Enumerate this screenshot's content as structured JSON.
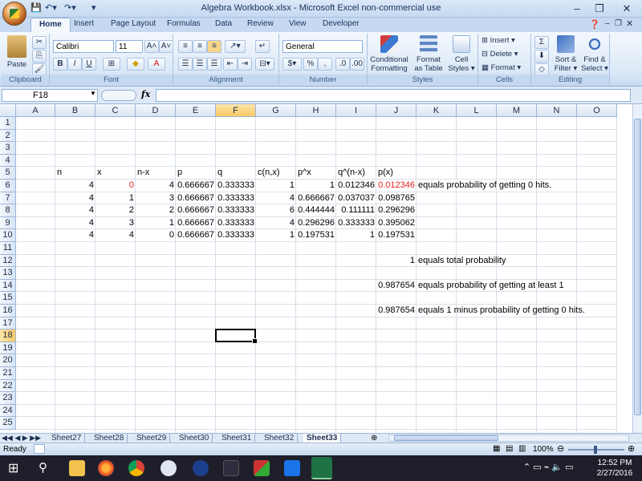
{
  "window": {
    "title": "Algebra Workbook.xlsx - Microsoft Excel non-commercial use",
    "controls": {
      "minimize": "–",
      "restore": "❐",
      "close": "✕"
    }
  },
  "ribbon_tabs": [
    "Home",
    "Insert",
    "Page Layout",
    "Formulas",
    "Data",
    "Review",
    "View",
    "Developer"
  ],
  "ribbon": {
    "clipboard": {
      "label": "Clipboard",
      "paste": "Paste"
    },
    "font": {
      "label": "Font",
      "name": "Calibri",
      "size": "11"
    },
    "alignment": {
      "label": "Alignment"
    },
    "number": {
      "label": "Number",
      "format": "General"
    },
    "styles": {
      "label": "Styles",
      "cond": "Conditional Formatting ▾",
      "table": "Format as Table ▾",
      "cell": "Cell Styles ▾"
    },
    "cells": {
      "label": "Cells",
      "insert": "Insert ▾",
      "delete": "Delete ▾",
      "format": "Format ▾"
    },
    "editing": {
      "label": "Editing",
      "sort": "Sort & Filter ▾",
      "find": "Find & Select ▾"
    }
  },
  "formula_bar": {
    "name_box": "F18",
    "fx": "fx",
    "formula": ""
  },
  "columns": [
    "A",
    "B",
    "C",
    "D",
    "E",
    "F",
    "G",
    "H",
    "I",
    "J",
    "K",
    "L",
    "M",
    "N",
    "O"
  ],
  "rows": [
    "1",
    "2",
    "3",
    "4",
    "5",
    "6",
    "7",
    "8",
    "9",
    "10",
    "11",
    "12",
    "13",
    "14",
    "15",
    "16",
    "17",
    "18",
    "19",
    "20",
    "21",
    "22",
    "23",
    "24",
    "25"
  ],
  "cells": [
    {
      "col": 1,
      "row": 5,
      "text": "n"
    },
    {
      "col": 2,
      "row": 5,
      "text": "x"
    },
    {
      "col": 3,
      "row": 5,
      "text": "n-x"
    },
    {
      "col": 4,
      "row": 5,
      "text": "p"
    },
    {
      "col": 5,
      "row": 5,
      "text": "q"
    },
    {
      "col": 6,
      "row": 5,
      "text": "c(n,x)"
    },
    {
      "col": 7,
      "row": 5,
      "text": "p^x"
    },
    {
      "col": 8,
      "row": 5,
      "text": "q^(n-x)"
    },
    {
      "col": 9,
      "row": 5,
      "text": "p(x)"
    },
    {
      "col": 1,
      "row": 6,
      "text": "4",
      "num": true
    },
    {
      "col": 2,
      "row": 6,
      "text": "0",
      "num": true,
      "red": true
    },
    {
      "col": 3,
      "row": 6,
      "text": "4",
      "num": true
    },
    {
      "col": 4,
      "row": 6,
      "text": "0.666667",
      "num": true
    },
    {
      "col": 5,
      "row": 6,
      "text": "0.333333",
      "num": true
    },
    {
      "col": 6,
      "row": 6,
      "text": "1",
      "num": true
    },
    {
      "col": 7,
      "row": 6,
      "text": "1",
      "num": true
    },
    {
      "col": 8,
      "row": 6,
      "text": "0.012346",
      "num": true
    },
    {
      "col": 9,
      "row": 6,
      "text": "0.012346",
      "num": true,
      "red": true
    },
    {
      "col": 10,
      "row": 6,
      "text": "equals probability of getting 0 hits."
    },
    {
      "col": 1,
      "row": 7,
      "text": "4",
      "num": true
    },
    {
      "col": 2,
      "row": 7,
      "text": "1",
      "num": true
    },
    {
      "col": 3,
      "row": 7,
      "text": "3",
      "num": true
    },
    {
      "col": 4,
      "row": 7,
      "text": "0.666667",
      "num": true
    },
    {
      "col": 5,
      "row": 7,
      "text": "0.333333",
      "num": true
    },
    {
      "col": 6,
      "row": 7,
      "text": "4",
      "num": true
    },
    {
      "col": 7,
      "row": 7,
      "text": "0.666667",
      "num": true
    },
    {
      "col": 8,
      "row": 7,
      "text": "0.037037",
      "num": true
    },
    {
      "col": 9,
      "row": 7,
      "text": "0.098765",
      "num": true
    },
    {
      "col": 1,
      "row": 8,
      "text": "4",
      "num": true
    },
    {
      "col": 2,
      "row": 8,
      "text": "2",
      "num": true
    },
    {
      "col": 3,
      "row": 8,
      "text": "2",
      "num": true
    },
    {
      "col": 4,
      "row": 8,
      "text": "0.666667",
      "num": true
    },
    {
      "col": 5,
      "row": 8,
      "text": "0.333333",
      "num": true
    },
    {
      "col": 6,
      "row": 8,
      "text": "6",
      "num": true
    },
    {
      "col": 7,
      "row": 8,
      "text": "0.444444",
      "num": true
    },
    {
      "col": 8,
      "row": 8,
      "text": "0.111111",
      "num": true
    },
    {
      "col": 9,
      "row": 8,
      "text": "0.296296",
      "num": true
    },
    {
      "col": 1,
      "row": 9,
      "text": "4",
      "num": true
    },
    {
      "col": 2,
      "row": 9,
      "text": "3",
      "num": true
    },
    {
      "col": 3,
      "row": 9,
      "text": "1",
      "num": true
    },
    {
      "col": 4,
      "row": 9,
      "text": "0.666667",
      "num": true
    },
    {
      "col": 5,
      "row": 9,
      "text": "0.333333",
      "num": true
    },
    {
      "col": 6,
      "row": 9,
      "text": "4",
      "num": true
    },
    {
      "col": 7,
      "row": 9,
      "text": "0.296296",
      "num": true
    },
    {
      "col": 8,
      "row": 9,
      "text": "0.333333",
      "num": true
    },
    {
      "col": 9,
      "row": 9,
      "text": "0.395062",
      "num": true
    },
    {
      "col": 1,
      "row": 10,
      "text": "4",
      "num": true
    },
    {
      "col": 2,
      "row": 10,
      "text": "4",
      "num": true
    },
    {
      "col": 3,
      "row": 10,
      "text": "0",
      "num": true
    },
    {
      "col": 4,
      "row": 10,
      "text": "0.666667",
      "num": true
    },
    {
      "col": 5,
      "row": 10,
      "text": "0.333333",
      "num": true
    },
    {
      "col": 6,
      "row": 10,
      "text": "1",
      "num": true
    },
    {
      "col": 7,
      "row": 10,
      "text": "0.197531",
      "num": true
    },
    {
      "col": 8,
      "row": 10,
      "text": "1",
      "num": true
    },
    {
      "col": 9,
      "row": 10,
      "text": "0.197531",
      "num": true
    },
    {
      "col": 9,
      "row": 12,
      "text": "1",
      "num": true
    },
    {
      "col": 10,
      "row": 12,
      "text": "equals total probability"
    },
    {
      "col": 9,
      "row": 14,
      "text": "0.987654",
      "num": true
    },
    {
      "col": 10,
      "row": 14,
      "text": "equals probability of getting at least 1"
    },
    {
      "col": 9,
      "row": 16,
      "text": "0.987654",
      "num": true
    },
    {
      "col": 10,
      "row": 16,
      "text": "equals 1 minus probability of getting 0 hits."
    }
  ],
  "active_cell": {
    "col": 5,
    "row": 18
  },
  "sheets": [
    "Sheet27",
    "Sheet28",
    "Sheet29",
    "Sheet30",
    "Sheet31",
    "Sheet32",
    "Sheet33"
  ],
  "active_sheet": "Sheet33",
  "status": {
    "ready": "Ready",
    "zoom": "100%"
  },
  "clock": {
    "time": "12:52 PM",
    "date": "2/27/2016"
  },
  "colors": {
    "accent": "#c6d9f0",
    "selected_header": "#f7c866",
    "red_text": "#e02020"
  }
}
